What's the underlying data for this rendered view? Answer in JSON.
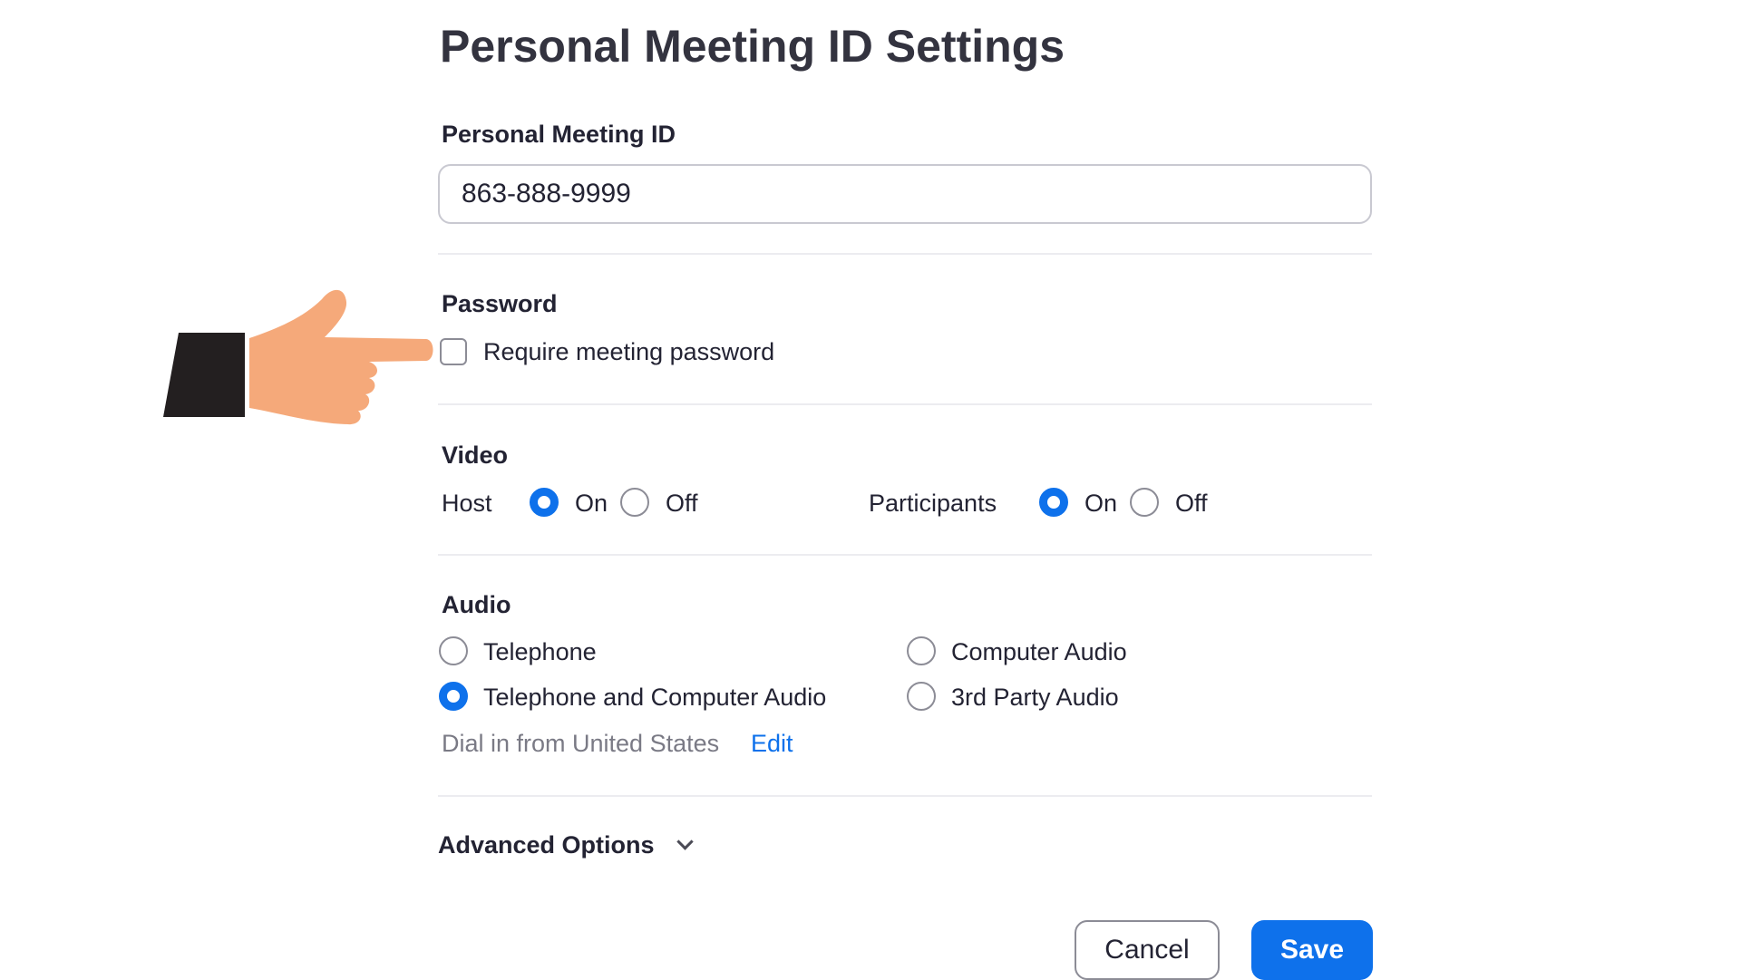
{
  "title": "Personal Meeting ID Settings",
  "pmi": {
    "label": "Personal Meeting ID",
    "value": "863-888-9999"
  },
  "password": {
    "label": "Password",
    "option_label": "Require meeting password",
    "checked": false
  },
  "video": {
    "label": "Video",
    "host": {
      "label": "Host",
      "on_label": "On",
      "off_label": "Off",
      "selected": "On"
    },
    "participants": {
      "label": "Participants",
      "on_label": "On",
      "off_label": "Off",
      "selected": "On"
    }
  },
  "audio": {
    "label": "Audio",
    "options": [
      "Telephone",
      "Computer Audio",
      "Telephone and Computer Audio",
      "3rd Party Audio"
    ],
    "selected": "Telephone and Computer Audio",
    "dial_in_text": "Dial in from United States",
    "edit_label": "Edit"
  },
  "advanced": {
    "label": "Advanced Options",
    "icon": "chevron-down-icon"
  },
  "buttons": {
    "cancel_label": "Cancel",
    "save_label": "Save"
  },
  "colors": {
    "accent": "#0e71eb",
    "hand_skin": "#f5a97a",
    "sleeve": "#231f20"
  }
}
